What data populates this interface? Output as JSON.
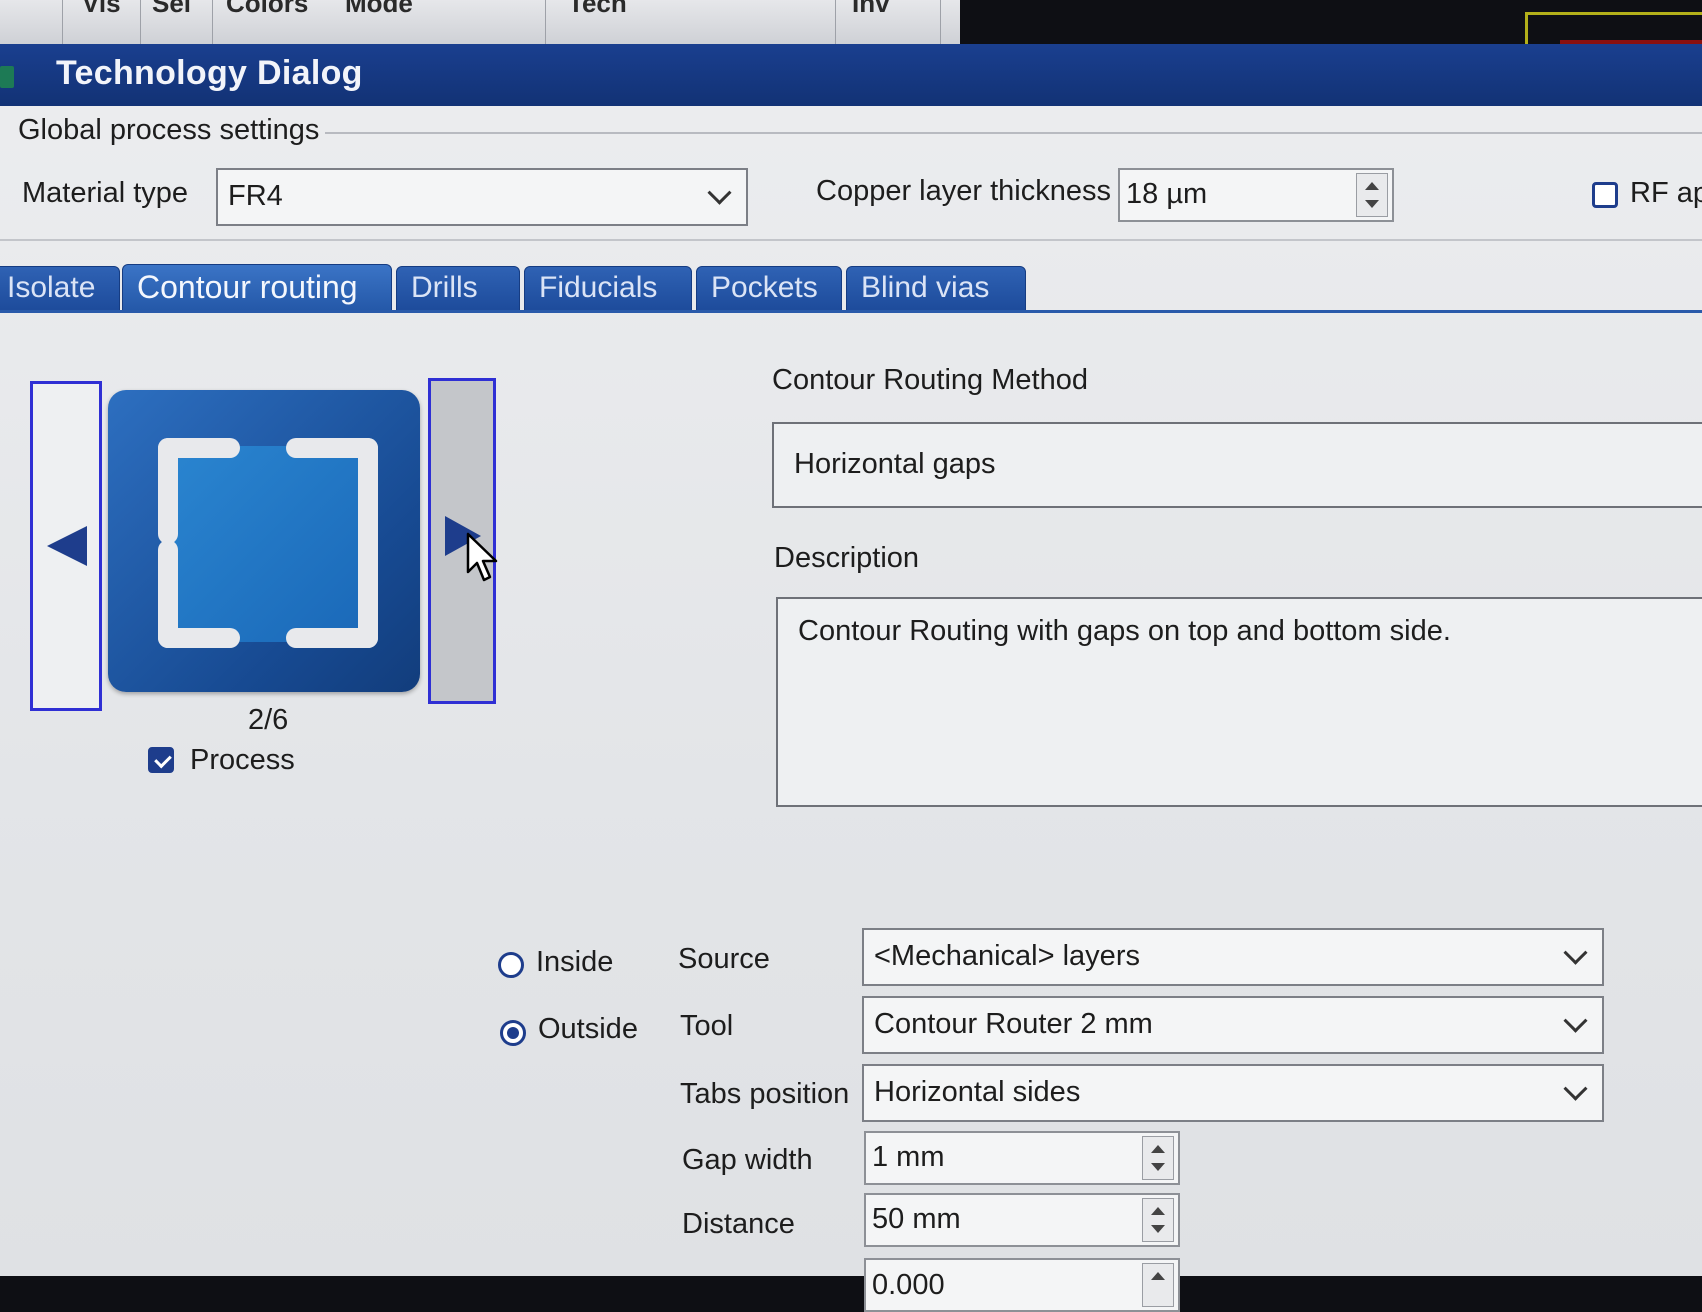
{
  "background_app": {
    "columns": [
      "Vis",
      "Sel",
      "Colors",
      "Mode",
      "Tech",
      "Inv"
    ]
  },
  "dialog": {
    "title": "Technology Dialog"
  },
  "global": {
    "group_label": "Global process settings",
    "material_label": "Material type",
    "material_value": "FR4",
    "copper_label": "Copper layer thickness",
    "copper_value": "18 µm",
    "rf_label": "RF app",
    "rf_checked": false
  },
  "tabs": [
    {
      "label": "Isolate",
      "active": false
    },
    {
      "label": "Contour routing",
      "active": true
    },
    {
      "label": "Drills",
      "active": false
    },
    {
      "label": "Fiducials",
      "active": false
    },
    {
      "label": "Pockets",
      "active": false
    },
    {
      "label": "Blind vias",
      "active": false
    }
  ],
  "carousel": {
    "counter": "2/6",
    "process_label": "Process",
    "process_checked": true
  },
  "method": {
    "heading": "Contour Routing Method",
    "value": "Horizontal gaps",
    "description_label": "Description",
    "description": "Contour Routing with gaps on top and bottom side."
  },
  "options": {
    "inside_label": "Inside",
    "outside_label": "Outside",
    "selected": "Outside",
    "source_label": "Source",
    "source_value": "<Mechanical> layers",
    "tool_label": "Tool",
    "tool_value": "Contour Router 2 mm",
    "tabs_position_label": "Tabs position",
    "tabs_position_value": "Horizontal sides",
    "gap_width_label": "Gap width",
    "gap_width_value": "1 mm",
    "distance_label": "Distance",
    "distance_value": "50 mm",
    "partial_value": "0.000"
  },
  "colors": {
    "titlebar": "#1a3f8f",
    "tab": "#2458a8",
    "accent": "#1e3d8c",
    "nav_border": "#2f2fd4"
  }
}
